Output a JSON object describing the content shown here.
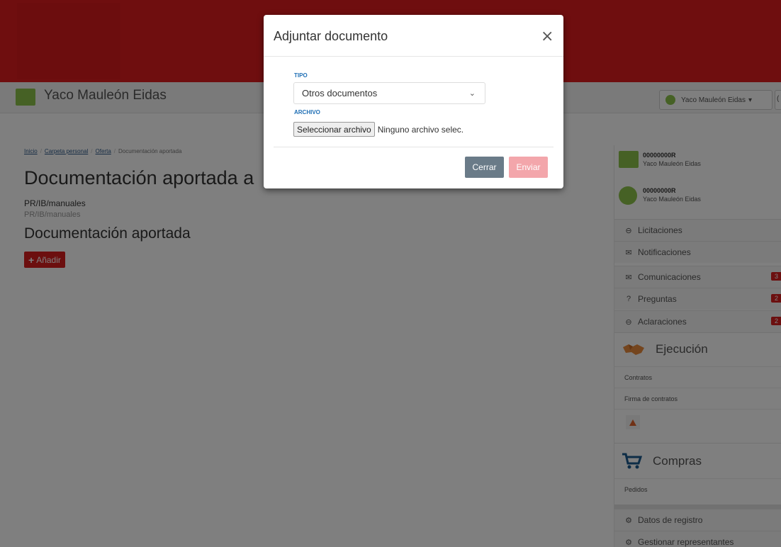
{
  "header": {
    "brand_name": "Yaco Mauleón Eidas",
    "user_menu_label": "Yaco Mauleón Eidas",
    "user_menu_caret": "▾",
    "extra_button_label": "("
  },
  "breadcrumb": {
    "items": [
      "Inicio",
      "Carpeta personal",
      "Oferta",
      "Documentación aportada"
    ],
    "separator": "/"
  },
  "main": {
    "title": "Documentación aportada a",
    "code_bold": "PR/IB/manuales",
    "code_muted": "PR/IB/manuales",
    "section_title": "Documentación aportada",
    "add_button_label": "Añadir",
    "add_button_icon": "+"
  },
  "sidebar": {
    "accounts": [
      {
        "id": "00000000R",
        "name": "Yaco Mauleón Eidas"
      },
      {
        "id": "00000000R",
        "name": "Yaco Mauleón Eidas"
      }
    ],
    "menu": [
      {
        "label": "Licitaciones",
        "icon": "inbox-icon",
        "glyph": "⊖",
        "badge": ""
      },
      {
        "label": "Notificaciones",
        "icon": "envelope-icon",
        "glyph": "✉",
        "badge": ""
      },
      {
        "label": "Comunicaciones",
        "icon": "envelope-icon",
        "glyph": "✉",
        "badge": "3"
      },
      {
        "label": "Preguntas",
        "icon": "question-icon",
        "glyph": "?",
        "badge": "2"
      },
      {
        "label": "Aclaraciones",
        "icon": "inbox-icon",
        "glyph": "⊖",
        "badge": "2"
      }
    ],
    "ejecucion": {
      "title": "Ejecución",
      "icon": "handshake-icon",
      "items": [
        "Contratos",
        "Firma de contratos"
      ]
    },
    "compras": {
      "title": "Compras",
      "icon": "cart-icon",
      "items": [
        "Pedidos"
      ]
    },
    "bottom_menu": [
      {
        "label": "Datos de registro",
        "icon": "gear-icon",
        "glyph": "⚙"
      },
      {
        "label": "Gestionar representantes",
        "icon": "gear-icon",
        "glyph": "⚙"
      }
    ]
  },
  "modal": {
    "title": "Adjuntar documento",
    "close_glyph": "×",
    "tipo_label": "TIPO",
    "tipo_value": "Otros documentos",
    "tipo_chevron": "⌄",
    "archivo_label": "ARCHIVO",
    "file_button_label": "Seleccionar archivo",
    "file_status": "Ninguno archivo selec.",
    "cancel_label": "Cerrar",
    "submit_label": "Enviar"
  },
  "colors": {
    "brand_red": "#de1c1f",
    "accent_green": "#8dc34a",
    "label_blue": "#1f6fb5",
    "cancel_gray": "#6a7b88",
    "submit_disabled": "#f3a6ab"
  }
}
